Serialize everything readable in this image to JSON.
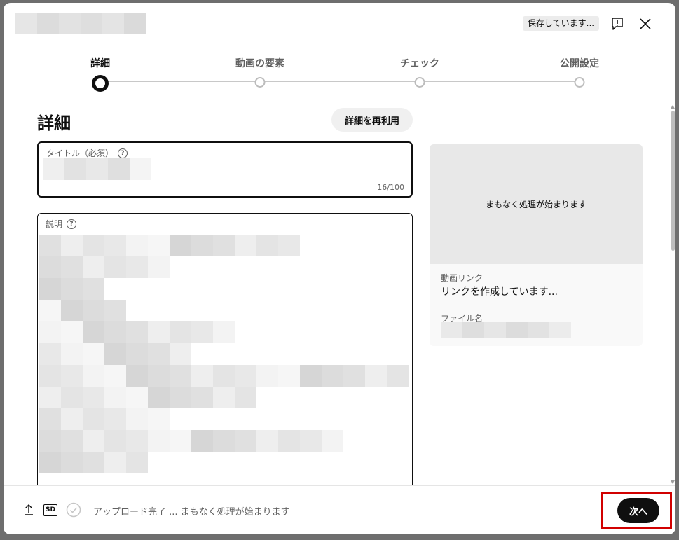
{
  "header": {
    "title_blur": [
      "#e6e6e6",
      "#dcdcdc",
      "#e2e2e2",
      "#dedede",
      "#e4e4e4",
      "#dadada"
    ],
    "saving_badge": "保存しています...",
    "feedback_icon": "feedback-icon",
    "close_icon": "close-icon"
  },
  "stepper": {
    "steps": [
      {
        "label": "詳細"
      },
      {
        "label": "動画の要素"
      },
      {
        "label": "チェック"
      },
      {
        "label": "公開設定"
      }
    ],
    "active_index": 0
  },
  "details": {
    "section_title": "詳細",
    "reuse_button": "詳細を再利用",
    "title_field": {
      "label": "タイトル（必須）",
      "help": "?",
      "counter": "16/100"
    },
    "description_field": {
      "label": "説明",
      "help": "?"
    }
  },
  "side_card": {
    "preview_text": "まもなく処理が始まります",
    "video_link_label": "動画リンク",
    "video_link_value": "リンクを作成しています...",
    "file_name_label": "ファイル名"
  },
  "footer": {
    "upload_icon": "upload-icon",
    "sd_badge": "SD",
    "check_icon": "check-circle-icon",
    "status_text": "アップロード完了 ... まもなく処理が始まります",
    "next_button": "次へ"
  },
  "colors": {
    "primary": "#0f0f0f",
    "secondary_text": "#606060",
    "highlight": "#d10000"
  }
}
